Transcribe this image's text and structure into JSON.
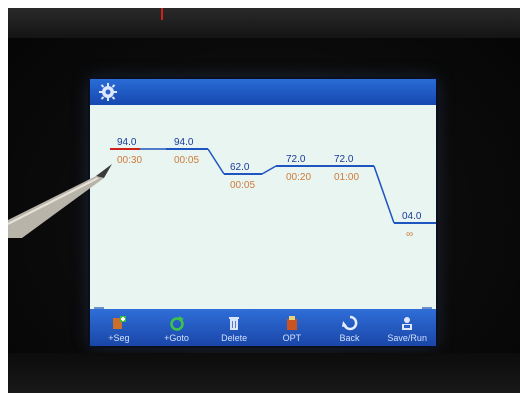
{
  "window": {
    "title": ""
  },
  "colors": {
    "screen_bg": "#e6f4ef",
    "bar_blue": "#1f55c0",
    "temp_text": "#1a3a9a",
    "time_text": "#d07a3a",
    "selected_step": "#d0201a"
  },
  "toolbar": {
    "settings_icon": "gear-icon"
  },
  "program": {
    "steps": [
      {
        "temp": "94.0",
        "time": "00:30",
        "selected": true
      },
      {
        "temp": "94.0",
        "time": "00:05",
        "selected": false
      },
      {
        "temp": "62.0",
        "time": "00:05",
        "selected": false
      },
      {
        "temp": "72.0",
        "time": "00:20",
        "selected": false
      },
      {
        "temp": "72.0",
        "time": "01:00",
        "selected": false
      },
      {
        "temp": "04.0",
        "time": "∞",
        "selected": false
      }
    ]
  },
  "buttons": [
    {
      "label": "+Seg",
      "icon": "add-segment-icon"
    },
    {
      "label": "+Goto",
      "icon": "add-goto-icon"
    },
    {
      "label": "Delete",
      "icon": "trash-icon"
    },
    {
      "label": "OPT",
      "icon": "options-icon"
    },
    {
      "label": "Back",
      "icon": "back-icon"
    },
    {
      "label": "Save/Run",
      "icon": "save-run-icon"
    }
  ],
  "scroll": {
    "left": "‹",
    "right": "›"
  }
}
